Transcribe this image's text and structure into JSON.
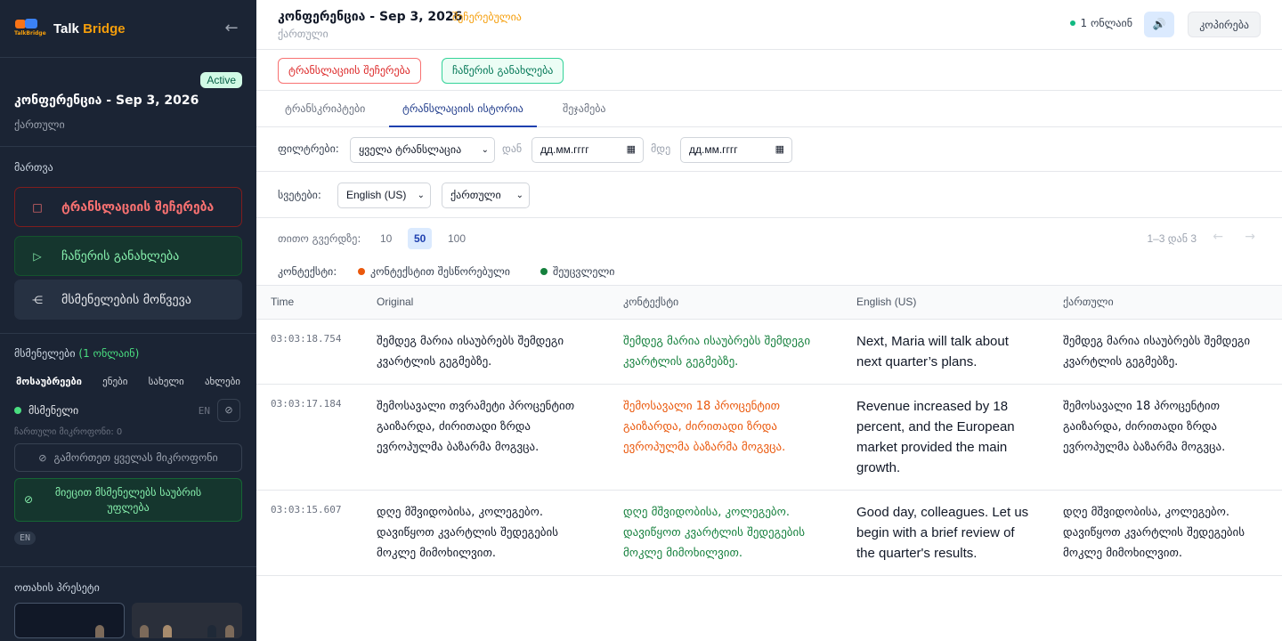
{
  "sidebar": {
    "brand": {
      "logo_text": "TalkBridge",
      "name_main": "Talk",
      "name_accent": "Bridge"
    },
    "conference": {
      "status_badge": "Active",
      "title": "კონფერენცია - Sep 3, 2026",
      "language": "ქართული"
    },
    "controls": {
      "label": "მართვა",
      "stop_label": "ტრანსლაციის შეჩერება",
      "resume_label": "ჩაწერის განახლება",
      "invite_label": "მსმენელების მოწვევა"
    },
    "listeners": {
      "label": "მსმენელები",
      "count_label": "(1 ონლაინ)",
      "tabs": [
        "მოსაუბრეები",
        "ენები",
        "სახელი",
        "ახლები"
      ],
      "items": [
        {
          "name": "მსმენელი",
          "lang": "EN"
        }
      ],
      "mics_enabled": "ჩართული მიკროფონი: 0",
      "mute_all_label": "გამორთეთ ყველას მიკროფონი",
      "grant_label": "მიეცით მსმენელებს საუბრის უფლება",
      "lang_chip": "EN"
    },
    "presets": {
      "label": "ოთახის პრესეტი"
    }
  },
  "header": {
    "title": "კონფერენცია - Sep 3, 2026",
    "status": "შეჩერებულია",
    "language": "ქართული",
    "online": "1 ონლაინ",
    "copy_label": "კოპირება"
  },
  "actions": {
    "stop_label": "ტრანსლაციის შეჩერება",
    "resume_label": "ჩაწერის განახლება"
  },
  "tabs": [
    "ტრანსკრიპტები",
    "ტრანსლაციის ისტორია",
    "შეჯამება"
  ],
  "filters": {
    "label": "ფილტრები:",
    "type_value": "ყველა ტრანსლაცია",
    "from_label": "დან",
    "from_placeholder": "дд.мм.гггг",
    "to_label": "მდე",
    "to_placeholder": "дд.мм.гггг"
  },
  "columns_filter": {
    "label": "სვეტები:",
    "col1": "English (US)",
    "col2": "ქართული"
  },
  "pagination": {
    "label": "თითო გვერდზე:",
    "sizes": [
      "10",
      "50",
      "100"
    ],
    "selected": "50",
    "range": "1–3 დან 3"
  },
  "legend": {
    "label": "კონტექსტი:",
    "corrected": "კონტექსტით შესწორებული",
    "unchanged": "შეუცვლელი",
    "corrected_color": "#ea580c",
    "unchanged_color": "#15803d"
  },
  "table": {
    "headers": [
      "Time",
      "Original",
      "კონტექსტი",
      "English (US)",
      "ქართული"
    ],
    "rows": [
      {
        "time": "03:03:18.754",
        "original": "შემდეგ მარია ისაუბრებს შემდეგი კვარტლის გეგმებზე.",
        "context": "შემდეგ მარია ისაუბრებს შემდეგი კვარტლის გეგმებზე.",
        "context_state": "unchanged",
        "english": "Next, Maria will talk about next quarter’s plans.",
        "georgian": "შემდეგ მარია ისაუბრებს შემდეგი კვარტლის გეგმებზე."
      },
      {
        "time": "03:03:17.184",
        "original": "შემოსავალი თვრამეტი პროცენტით გაიზარდა, ძირითადი ზრდა ევროპულმა ბაზარმა მოგვცა.",
        "context": "შემოსავალი 18 პროცენტით გაიზარდა, ძირითადი ზრდა ევროპულმა ბაზარმა მოგვცა.",
        "context_state": "corrected",
        "english": "Revenue increased by 18 percent, and the European market provided the main growth.",
        "georgian": "შემოსავალი 18 პროცენტით გაიზარდა, ძირითადი ზრდა ევროპულმა ბაზარმა მოგვცა."
      },
      {
        "time": "03:03:15.607",
        "original": "დღე მშვიდობისა, კოლეგებო. დავიწყოთ კვარტლის შედეგების მოკლე მიმოხილვით.",
        "context": "დღე მშვიდობისა, კოლეგებო. დავიწყოთ კვარტლის შედეგების მოკლე მიმოხილვით.",
        "context_state": "unchanged",
        "english": "Good day, colleagues. Let us begin with a brief review of the quarter's results.",
        "georgian": "დღე მშვიდობისა, კოლეგებო. დავიწყოთ კვარტლის შედეგების მოკლე მიმოხილვით."
      }
    ]
  }
}
